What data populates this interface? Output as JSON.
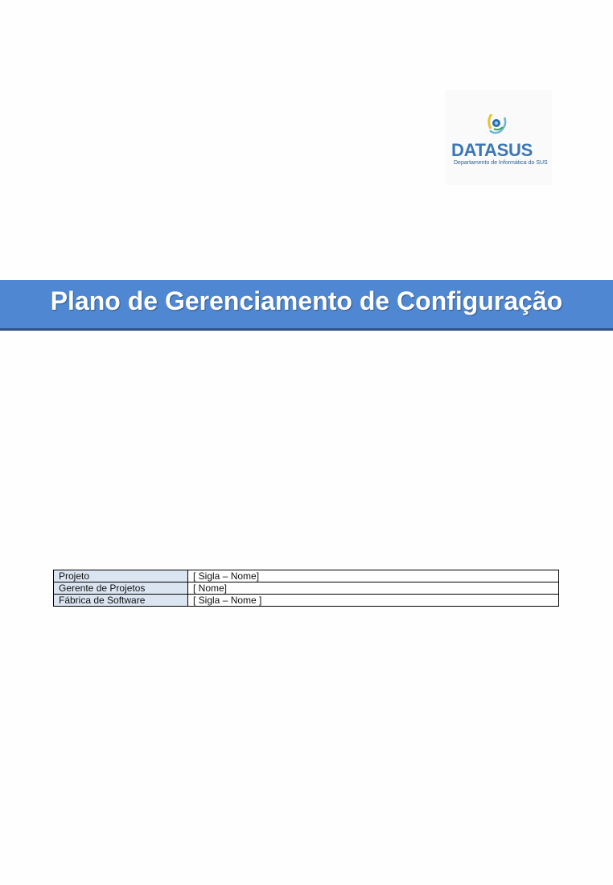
{
  "logo": {
    "name": "DATASUS",
    "subtitle": "Departamento de Informática do SUS"
  },
  "title": "Plano de Gerenciamento de Configuração",
  "info_table": [
    {
      "label": "Projeto",
      "value": "[ Sigla – Nome]"
    },
    {
      "label": "Gerente de Projetos",
      "value": "[ Nome]"
    },
    {
      "label": "Fábrica de Software",
      "value": "[ Sigla – Nome ]"
    }
  ],
  "colors": {
    "title_band": "#4f87d2",
    "label_cell": "#dbe5f1",
    "logo_blue": "#3b77b3"
  }
}
